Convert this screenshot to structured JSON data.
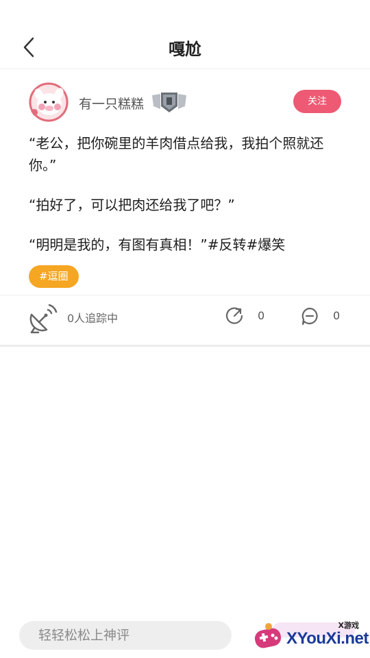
{
  "header": {
    "title": "嘎尬",
    "back_icon": "chevron-left-icon"
  },
  "post": {
    "author": {
      "name": "有一只糕糕",
      "avatar_icon": "pig-avatar-icon",
      "badge_icon": "level-shield-badge-icon"
    },
    "follow_label": "关注",
    "paragraphs": [
      "“老公，把你碗里的羊肉借点给我，我拍个照就还你。”",
      "“拍好了，可以把肉还给我了吧？”",
      "“明明是我的，有图有真相！”#反转#爆笑"
    ],
    "topic_tag": "#逗圈"
  },
  "stats": {
    "tracking_text": "0人追踪中",
    "repost_count": "0",
    "comment_count": "0",
    "icons": [
      "satellite-dish-icon",
      "repost-icon",
      "comment-icon"
    ]
  },
  "comment_box": {
    "placeholder": "轻轻松松上神评"
  },
  "watermark": {
    "small_text": "X游戏",
    "main_text": "XYouXi.net"
  },
  "colors": {
    "follow_button": "#ee5a73",
    "topic_tag": "#f5a623",
    "watermark_text": "#1a3a9a"
  }
}
